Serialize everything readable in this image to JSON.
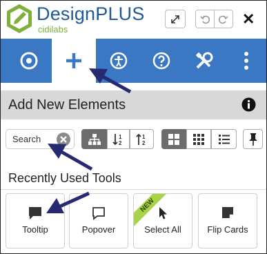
{
  "app": {
    "brand_name": "DesignPLUS",
    "brand_sub": "cidilabs"
  },
  "header": {
    "expand_icon": "expand-icon",
    "undo_icon": "undo-icon",
    "redo_icon": "redo-icon",
    "close_label": "✕"
  },
  "nav": {
    "tabs": [
      {
        "icon": "target-icon",
        "active": false
      },
      {
        "icon": "plus-icon",
        "active": true
      },
      {
        "icon": "accessibility-icon",
        "active": false
      },
      {
        "icon": "help-icon",
        "active": false
      },
      {
        "icon": "tools-icon",
        "active": false
      },
      {
        "icon": "more-icon",
        "active": false
      }
    ]
  },
  "section": {
    "title": "Add New Elements"
  },
  "search": {
    "placeholder": "Search"
  },
  "recent": {
    "title": "Recently Used Tools",
    "tools": [
      {
        "label": "Tooltip",
        "icon": "comment-icon",
        "badge": ""
      },
      {
        "label": "Popover",
        "icon": "comment-outline-icon",
        "badge": ""
      },
      {
        "label": "Select All",
        "icon": "cursor-icon",
        "badge": "NEW"
      },
      {
        "label": "Flip Cards",
        "icon": "sticky-note-icon",
        "badge": ""
      }
    ]
  },
  "colors": {
    "accent": "#3b78c4",
    "brand": "#1f5a96",
    "brand_green": "#7fb03b",
    "arrow": "#262a70",
    "new_badge": "#a8d34b"
  }
}
